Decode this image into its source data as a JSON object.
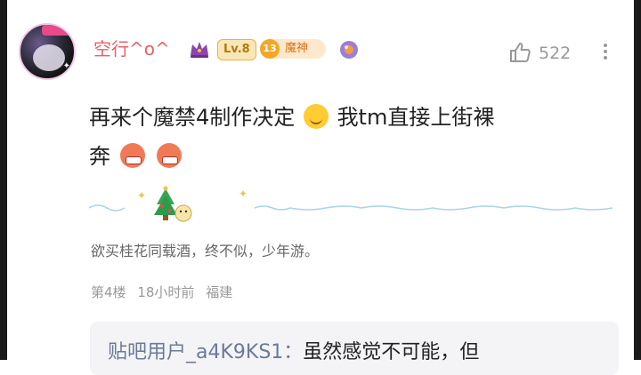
{
  "comment": {
    "username": "空行^o^",
    "level": "Lv.8",
    "rank_number": "13",
    "rank_title": "魔神",
    "like_count": "522",
    "content_line1": "再来个魔禁4制作决定",
    "content_line1b": "我tm直接上街裸",
    "content_line2": "奔",
    "signature": "欲买桂花同载酒，终不似，少年游。",
    "floor": "第4楼",
    "time": "18小时前",
    "location": "福建"
  },
  "reply_preview": {
    "user": "贴吧用户_a4K9KS1：",
    "text": "虽然感觉不可能，但"
  },
  "icons": {
    "crown": "crown-icon",
    "like": "thumbs-up-icon",
    "more": "more-vertical-icon"
  },
  "colors": {
    "username": "#e8606a",
    "level_bg": "#fbe7b5",
    "rank_accent": "#f5a623",
    "muted": "#999999"
  }
}
